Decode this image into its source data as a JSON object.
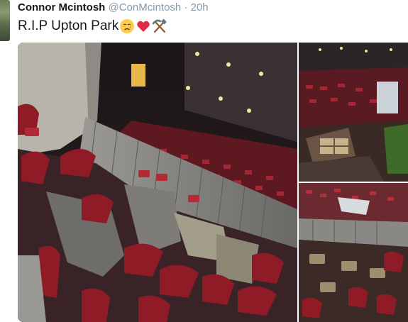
{
  "tweet": {
    "author_name": "Connor Mcintosh",
    "handle": "@ConMcintosh",
    "separator": "·",
    "time": "20h",
    "text": "R.I.P Upton Park",
    "emojis": [
      "crying-face-icon",
      "red-heart-icon",
      "hammer-and-pick-icon"
    ]
  },
  "colors": {
    "name": "#14171a",
    "meta": "#8899a6",
    "seat_red": "#8e1b26",
    "heart": "#e0245e"
  }
}
